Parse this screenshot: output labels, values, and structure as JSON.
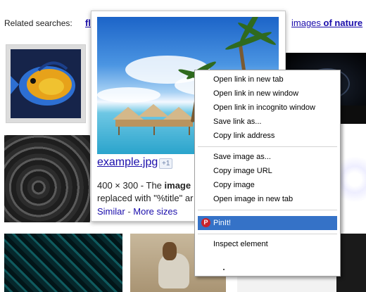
{
  "related": {
    "label": "Related searches:",
    "left_link": "fl",
    "right_link_prefix": "images ",
    "right_link_bold": "of nature"
  },
  "popup": {
    "filename": "example.jpg",
    "badge": "+1",
    "meta_prefix": "400 × 300 - The ",
    "meta_bold": "image",
    "desc": "replaced with \"%title\" ar",
    "similar": "Similar",
    "separator": " - ",
    "more_sizes": "More sizes"
  },
  "context_menu": {
    "group1": [
      "Open link in new tab",
      "Open link in new window",
      "Open link in incognito window",
      "Save link as...",
      "Copy link address"
    ],
    "group2": [
      "Save image as...",
      "Copy image URL",
      "Copy image",
      "Open image in new tab"
    ],
    "pinit": "PinIt!",
    "pin_icon_glyph": "P",
    "inspect": "Inspect element"
  },
  "colors": {
    "link": "#1a0dab",
    "menu_highlight": "#3572c7",
    "pin_icon": "#c8232c"
  }
}
